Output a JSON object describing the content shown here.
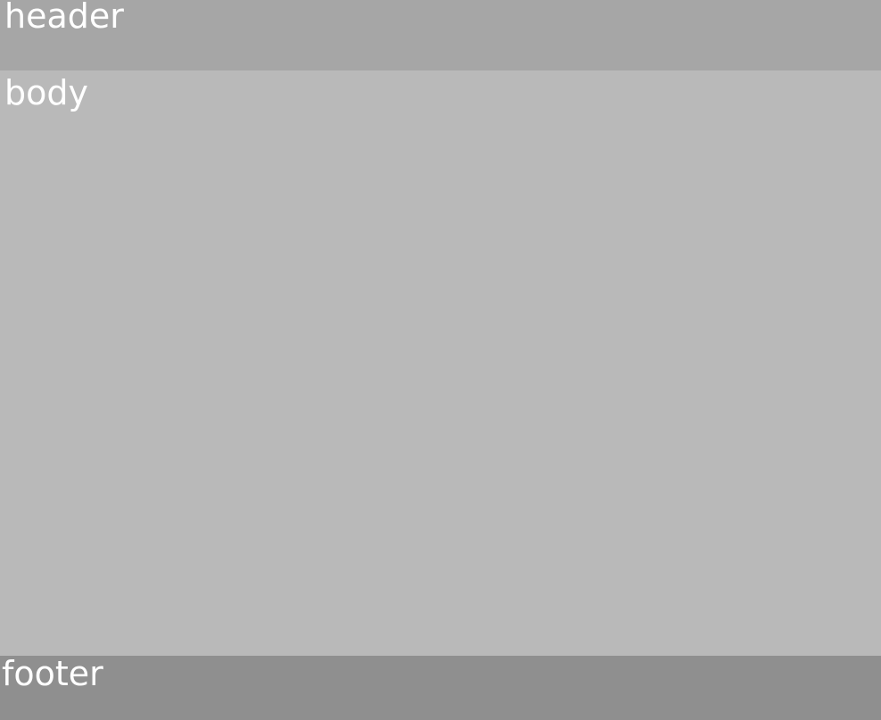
{
  "header": {
    "label": "header",
    "background_color": "#a6a6a6"
  },
  "body": {
    "label": "body",
    "background_color": "#b9b9b9"
  },
  "footer": {
    "label": "footer",
    "background_color": "#8f8f8f"
  },
  "text_color": "#ffffff"
}
